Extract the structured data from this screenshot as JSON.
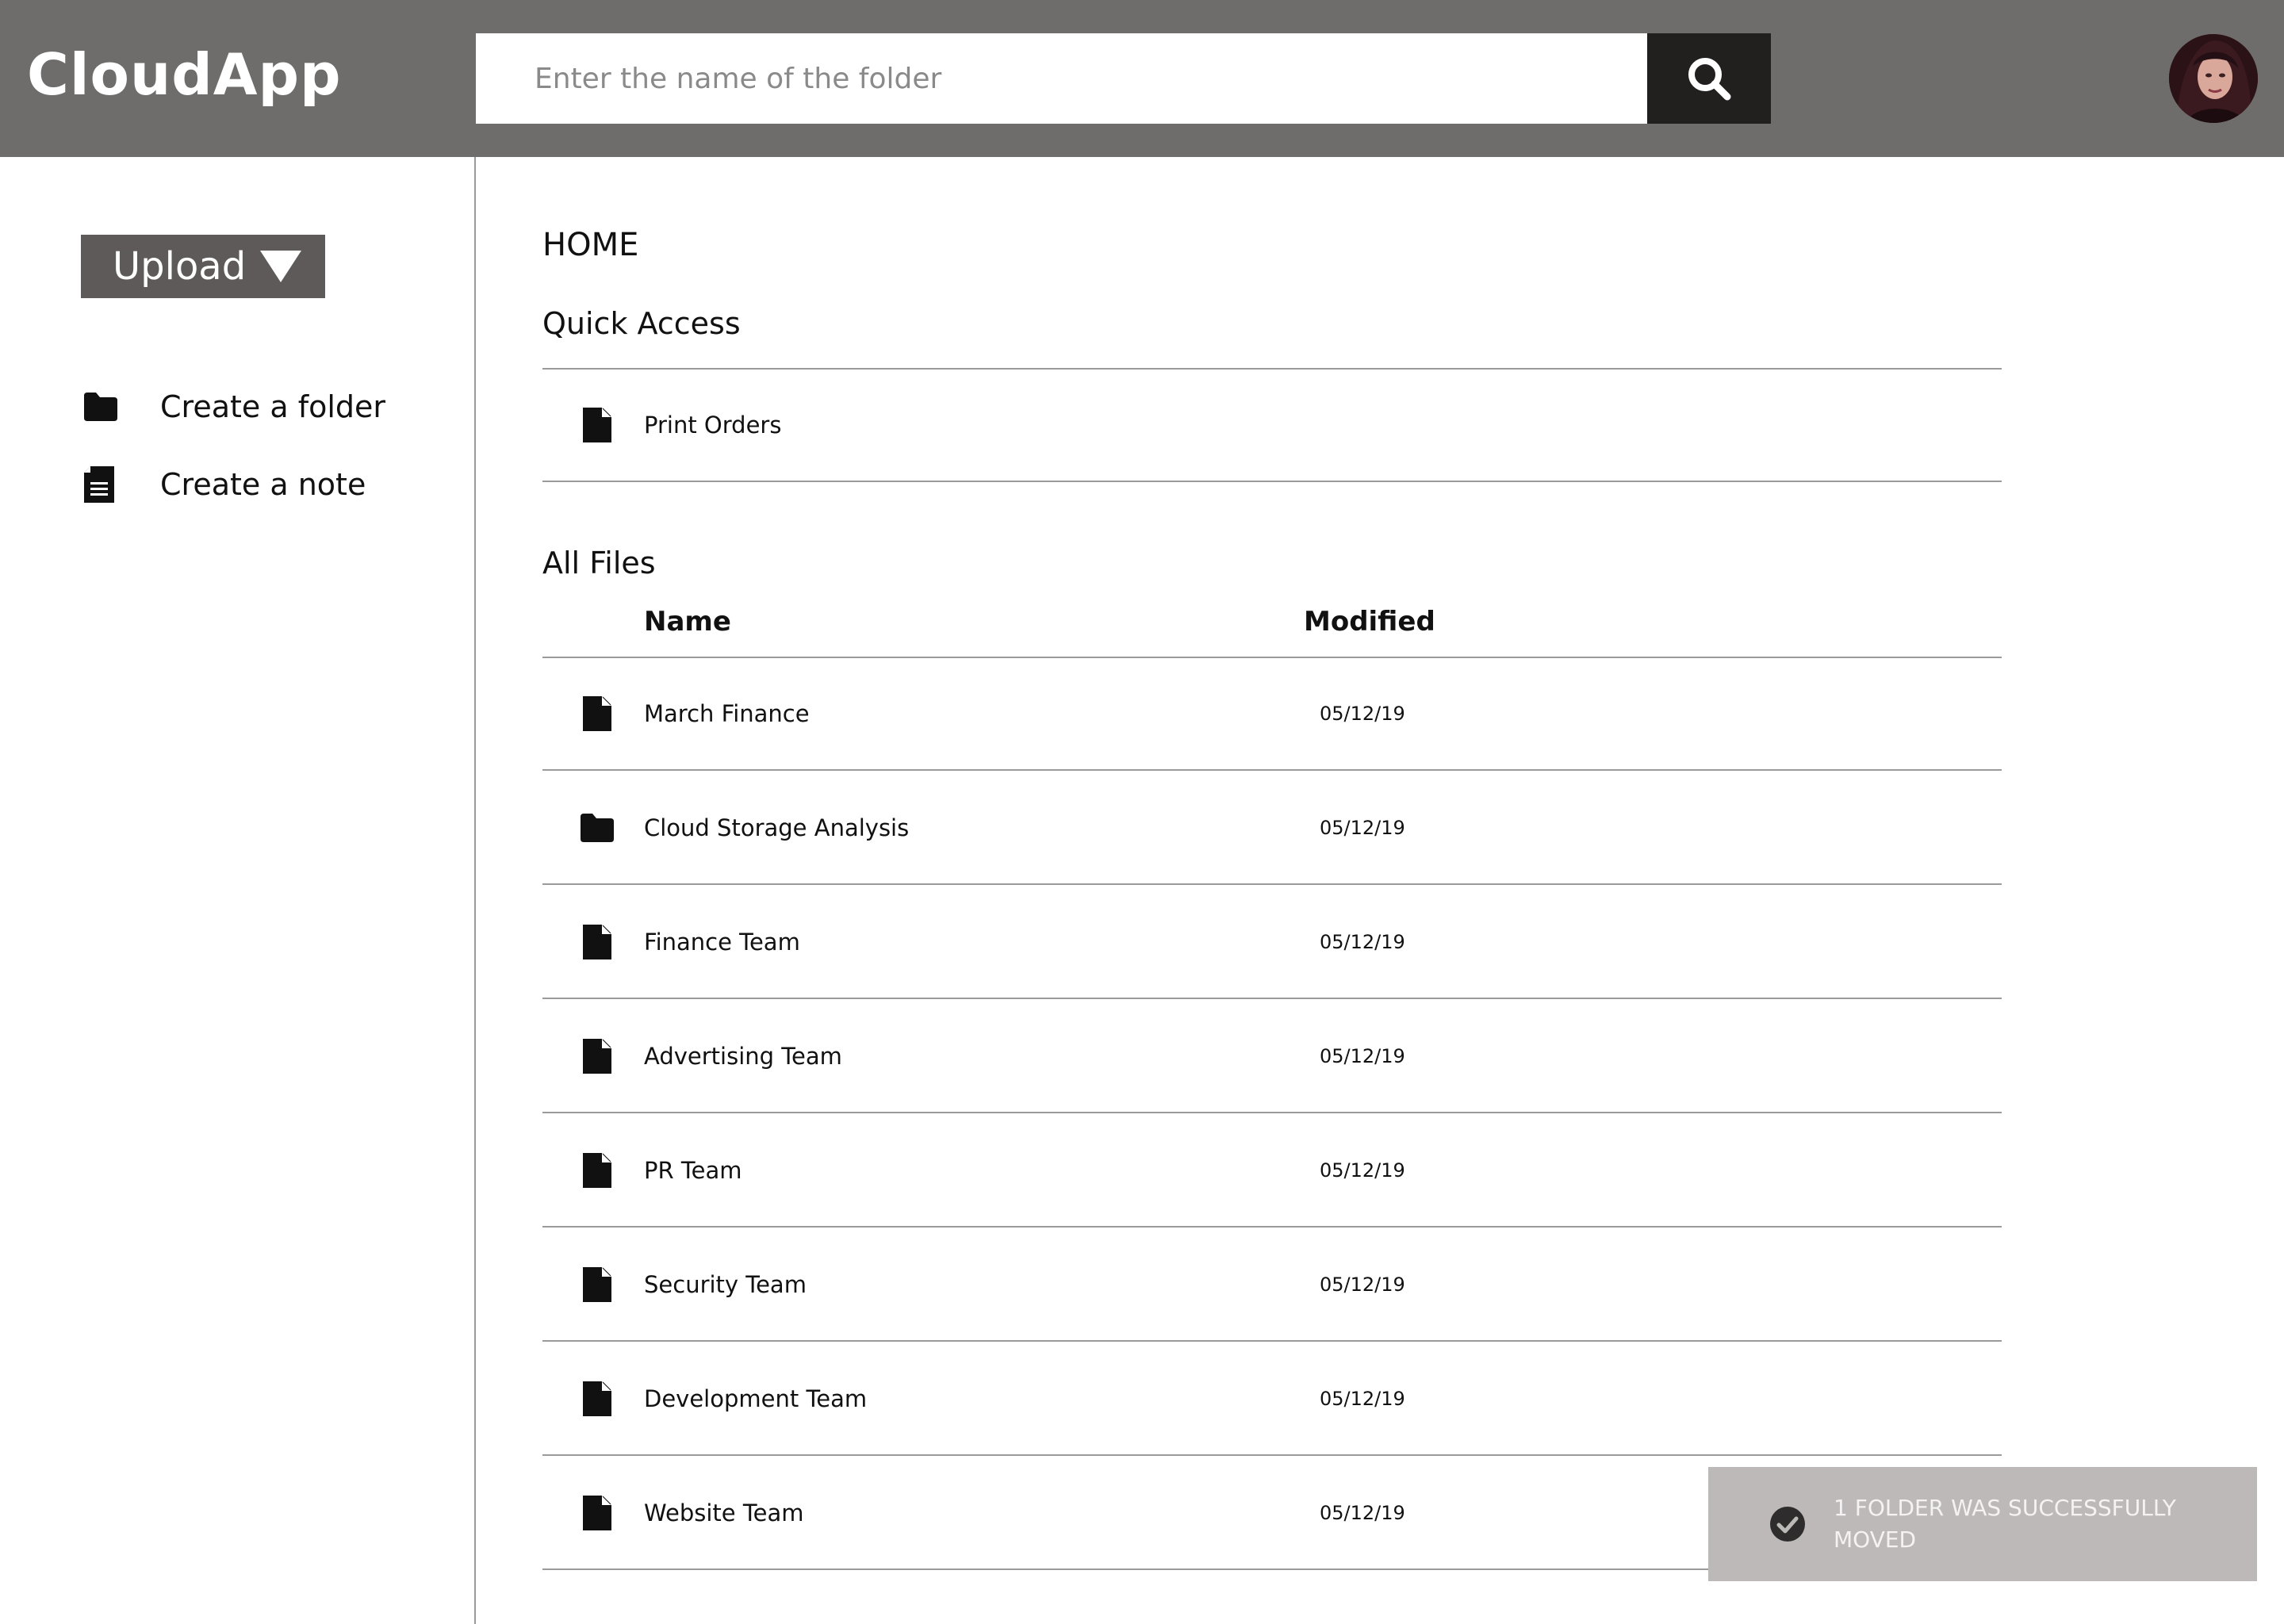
{
  "header": {
    "brand": "CloudApp",
    "search": {
      "placeholder": "Enter the name of the folder",
      "value": "",
      "icon": "search-icon"
    },
    "avatar_icon": "user-avatar"
  },
  "sidebar": {
    "upload_label": "Upload",
    "actions": [
      {
        "label": "Create a folder",
        "icon": "folder-icon"
      },
      {
        "label": "Create a note",
        "icon": "note-icon"
      }
    ]
  },
  "main": {
    "breadcrumb": "HOME",
    "quick_access": {
      "title": "Quick Access",
      "items": [
        {
          "name": "Print Orders",
          "type": "file"
        }
      ]
    },
    "all_files": {
      "title": "All Files",
      "columns": {
        "name": "Name",
        "modified": "Modified"
      },
      "rows": [
        {
          "name": "March Finance",
          "type": "file",
          "modified": "05/12/19"
        },
        {
          "name": "Cloud Storage Analysis",
          "type": "folder",
          "modified": "05/12/19"
        },
        {
          "name": "Finance Team",
          "type": "file",
          "modified": "05/12/19"
        },
        {
          "name": "Advertising Team",
          "type": "file",
          "modified": "05/12/19"
        },
        {
          "name": "PR Team",
          "type": "file",
          "modified": "05/12/19"
        },
        {
          "name": "Security Team",
          "type": "file",
          "modified": "05/12/19"
        },
        {
          "name": "Development Team",
          "type": "file",
          "modified": "05/12/19"
        },
        {
          "name": "Website Team",
          "type": "file",
          "modified": "05/12/19"
        }
      ]
    }
  },
  "toast": {
    "message": "1 FOLDER WAS SUCCESSFULLY MOVED",
    "icon": "check-circle-icon"
  },
  "colors": {
    "header_bg": "#6e6d6b",
    "search_button_bg": "#221f1f",
    "upload_bg": "#5e5a59",
    "toast_bg": "#bdb9b8",
    "divider": "#9a9a9a"
  }
}
